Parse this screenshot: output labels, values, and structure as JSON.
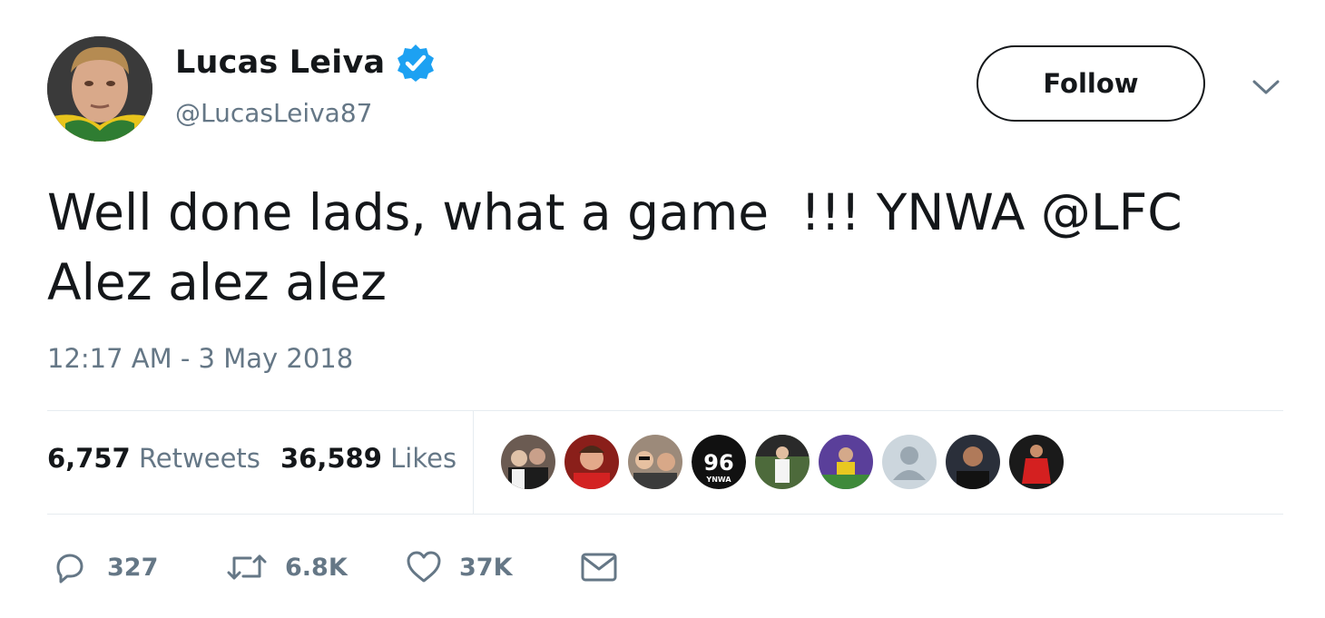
{
  "user": {
    "name": "Lucas Leiva",
    "handle": "@LucasLeiva87",
    "verified_icon": "verified-badge-icon",
    "verified_color": "#1da1f2"
  },
  "follow_button": {
    "label": "Follow"
  },
  "menu": {
    "icon": "chevron-down-icon"
  },
  "tweet": {
    "text": "Well done lads, what a game  !!! YNWA @LFC\nAlez alez alez",
    "timestamp": "12:17 AM - 3 May 2018"
  },
  "stats": {
    "retweets_count": "6,757",
    "retweets_label": "Retweets",
    "likes_count": "36,589",
    "likes_label": "Likes"
  },
  "liker_avatars": {
    "count_shown": 9,
    "badge_96": "96",
    "badge_ynwa": "YNWA"
  },
  "actions": {
    "reply_count": "327",
    "retweet_count": "6.8K",
    "like_count": "37K",
    "reply_icon": "reply-icon",
    "retweet_icon": "retweet-icon",
    "like_icon": "heart-icon",
    "message_icon": "envelope-icon"
  },
  "colors": {
    "text_primary": "#14171a",
    "text_secondary": "#657786",
    "divider": "#e6ecf0"
  }
}
